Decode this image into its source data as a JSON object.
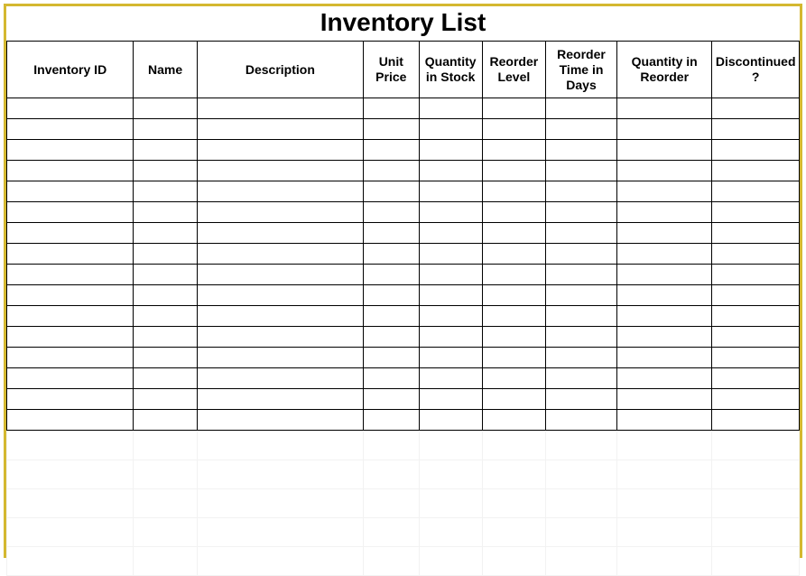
{
  "title": "Inventory List",
  "headers": {
    "inventory_id": "Inventory ID",
    "name": "Name",
    "description": "Description",
    "unit_price": "Unit Price",
    "quantity_in_stock": "Quantity in Stock",
    "reorder_level": "Reorder Level",
    "reorder_time_days": "Reorder Time in Days",
    "quantity_in_reorder": "Quantity in Reorder",
    "discontinued": "Discontinued?"
  },
  "rows": [
    {
      "inventory_id": "",
      "name": "",
      "description": "",
      "unit_price": "",
      "quantity_in_stock": "",
      "reorder_level": "",
      "reorder_time_days": "",
      "quantity_in_reorder": "",
      "discontinued": ""
    },
    {
      "inventory_id": "",
      "name": "",
      "description": "",
      "unit_price": "",
      "quantity_in_stock": "",
      "reorder_level": "",
      "reorder_time_days": "",
      "quantity_in_reorder": "",
      "discontinued": ""
    },
    {
      "inventory_id": "",
      "name": "",
      "description": "",
      "unit_price": "",
      "quantity_in_stock": "",
      "reorder_level": "",
      "reorder_time_days": "",
      "quantity_in_reorder": "",
      "discontinued": ""
    },
    {
      "inventory_id": "",
      "name": "",
      "description": "",
      "unit_price": "",
      "quantity_in_stock": "",
      "reorder_level": "",
      "reorder_time_days": "",
      "quantity_in_reorder": "",
      "discontinued": ""
    },
    {
      "inventory_id": "",
      "name": "",
      "description": "",
      "unit_price": "",
      "quantity_in_stock": "",
      "reorder_level": "",
      "reorder_time_days": "",
      "quantity_in_reorder": "",
      "discontinued": ""
    },
    {
      "inventory_id": "",
      "name": "",
      "description": "",
      "unit_price": "",
      "quantity_in_stock": "",
      "reorder_level": "",
      "reorder_time_days": "",
      "quantity_in_reorder": "",
      "discontinued": ""
    },
    {
      "inventory_id": "",
      "name": "",
      "description": "",
      "unit_price": "",
      "quantity_in_stock": "",
      "reorder_level": "",
      "reorder_time_days": "",
      "quantity_in_reorder": "",
      "discontinued": ""
    },
    {
      "inventory_id": "",
      "name": "",
      "description": "",
      "unit_price": "",
      "quantity_in_stock": "",
      "reorder_level": "",
      "reorder_time_days": "",
      "quantity_in_reorder": "",
      "discontinued": ""
    },
    {
      "inventory_id": "",
      "name": "",
      "description": "",
      "unit_price": "",
      "quantity_in_stock": "",
      "reorder_level": "",
      "reorder_time_days": "",
      "quantity_in_reorder": "",
      "discontinued": ""
    },
    {
      "inventory_id": "",
      "name": "",
      "description": "",
      "unit_price": "",
      "quantity_in_stock": "",
      "reorder_level": "",
      "reorder_time_days": "",
      "quantity_in_reorder": "",
      "discontinued": ""
    },
    {
      "inventory_id": "",
      "name": "",
      "description": "",
      "unit_price": "",
      "quantity_in_stock": "",
      "reorder_level": "",
      "reorder_time_days": "",
      "quantity_in_reorder": "",
      "discontinued": ""
    },
    {
      "inventory_id": "",
      "name": "",
      "description": "",
      "unit_price": "",
      "quantity_in_stock": "",
      "reorder_level": "",
      "reorder_time_days": "",
      "quantity_in_reorder": "",
      "discontinued": ""
    },
    {
      "inventory_id": "",
      "name": "",
      "description": "",
      "unit_price": "",
      "quantity_in_stock": "",
      "reorder_level": "",
      "reorder_time_days": "",
      "quantity_in_reorder": "",
      "discontinued": ""
    },
    {
      "inventory_id": "",
      "name": "",
      "description": "",
      "unit_price": "",
      "quantity_in_stock": "",
      "reorder_level": "",
      "reorder_time_days": "",
      "quantity_in_reorder": "",
      "discontinued": ""
    },
    {
      "inventory_id": "",
      "name": "",
      "description": "",
      "unit_price": "",
      "quantity_in_stock": "",
      "reorder_level": "",
      "reorder_time_days": "",
      "quantity_in_reorder": "",
      "discontinued": ""
    },
    {
      "inventory_id": "",
      "name": "",
      "description": "",
      "unit_price": "",
      "quantity_in_stock": "",
      "reorder_level": "",
      "reorder_time_days": "",
      "quantity_in_reorder": "",
      "discontinued": ""
    }
  ],
  "ghost_row_count": 5
}
